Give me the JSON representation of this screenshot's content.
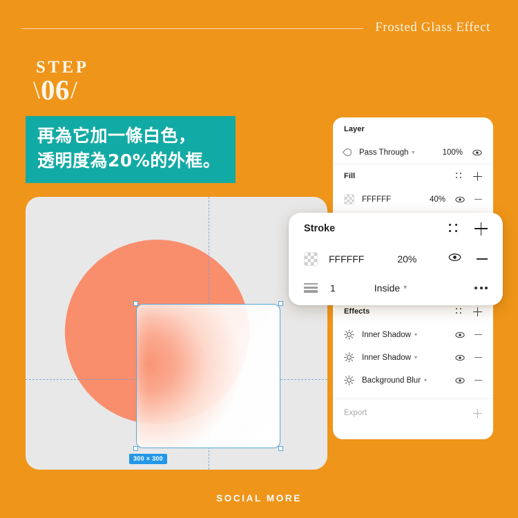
{
  "theme": {
    "background": "#ef9519",
    "accent_teal": "#12aaa4",
    "circle_color": "#f98e6d",
    "canvas_color": "#e8e8e8",
    "selection_blue": "#54a5d8",
    "badge_blue": "#2497e8",
    "cream": "#fdf6ea"
  },
  "header": {
    "title": "Frosted Glass Effect"
  },
  "step": {
    "word": "STEP",
    "number": "06",
    "slash_left": "/",
    "slash_right": "/"
  },
  "caption": {
    "line1": "再為它加一條白色，",
    "line2": "透明度為20%的外框。"
  },
  "canvas": {
    "size_badge": "300 × 300"
  },
  "panel": {
    "layer": {
      "title": "Layer",
      "blend_mode": "Pass Through",
      "opacity": "100%"
    },
    "fill": {
      "title": "Fill",
      "color": "FFFFFF",
      "opacity": "40%"
    },
    "effects": {
      "title": "Effects",
      "items": [
        {
          "label": "Inner Shadow"
        },
        {
          "label": "Inner Shadow"
        },
        {
          "label": "Background Blur"
        }
      ]
    },
    "export": {
      "label": "Export"
    }
  },
  "stroke_card": {
    "title": "Stroke",
    "color": "FFFFFF",
    "opacity": "20%",
    "weight": "1",
    "align": "Inside"
  },
  "footer": {
    "brand": "SOCIAL MORE"
  }
}
